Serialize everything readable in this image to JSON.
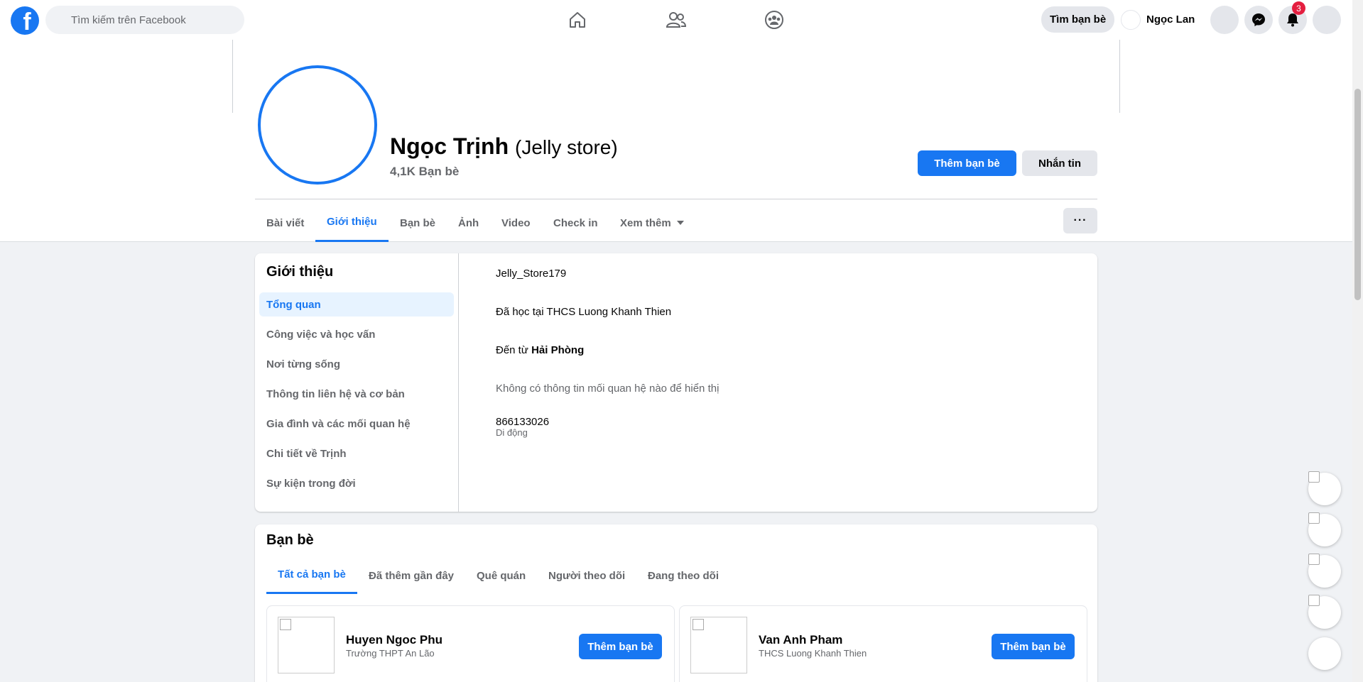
{
  "topbar": {
    "search_placeholder": "Tìm kiếm trên Facebook",
    "find_friends": "Tìm bạn bè",
    "user_name": "Ngọc Lan",
    "notifications_count": "3",
    "logo_letter": "f"
  },
  "profile": {
    "name": "Ngọc Trịnh",
    "alt_name": "(Jelly store)",
    "friend_count": "4,1K Bạn bè",
    "add_friend": "Thêm bạn bè",
    "message": "Nhắn tin",
    "more_dots": "···"
  },
  "tabs": [
    "Bài viết",
    "Giới thiệu",
    "Bạn bè",
    "Ảnh",
    "Video",
    "Check in",
    "Xem thêm"
  ],
  "active_tab": "Giới thiệu",
  "intro": {
    "title": "Giới thiệu",
    "menu": [
      "Tổng quan",
      "Công việc và học vấn",
      "Nơi từng sống",
      "Thông tin liên hệ và cơ bản",
      "Gia đình và các mối quan hệ",
      "Chi tiết về Trịnh",
      "Sự kiện trong đời"
    ],
    "active_menu": "Tổng quan",
    "username": "Jelly_Store179",
    "studied": "Đã học tại THCS Luong Khanh Thien",
    "from_prefix": "Đến từ ",
    "from_place": "Hải Phòng",
    "relationship": "Không có thông tin mối quan hệ nào để hiển thị",
    "phone": "866133026",
    "phone_label": "Di động"
  },
  "friends": {
    "title": "Bạn bè",
    "tabs": [
      "Tất cả bạn bè",
      "Đã thêm gần đây",
      "Quê quán",
      "Người theo dõi",
      "Đang theo dõi"
    ],
    "active_tab": "Tất cả bạn bè",
    "list": [
      {
        "name": "Huyen Ngoc Phu",
        "sub": "Trường THPT An Lão",
        "button": "Thêm bạn bè"
      },
      {
        "name": "Van Anh Pham",
        "sub": "THCS Luong Khanh Thien",
        "button": "Thêm bạn bè"
      }
    ]
  },
  "colors": {
    "accent": "#1877f2",
    "badge": "#e41e3f",
    "page_bg": "#f0f2f5"
  }
}
